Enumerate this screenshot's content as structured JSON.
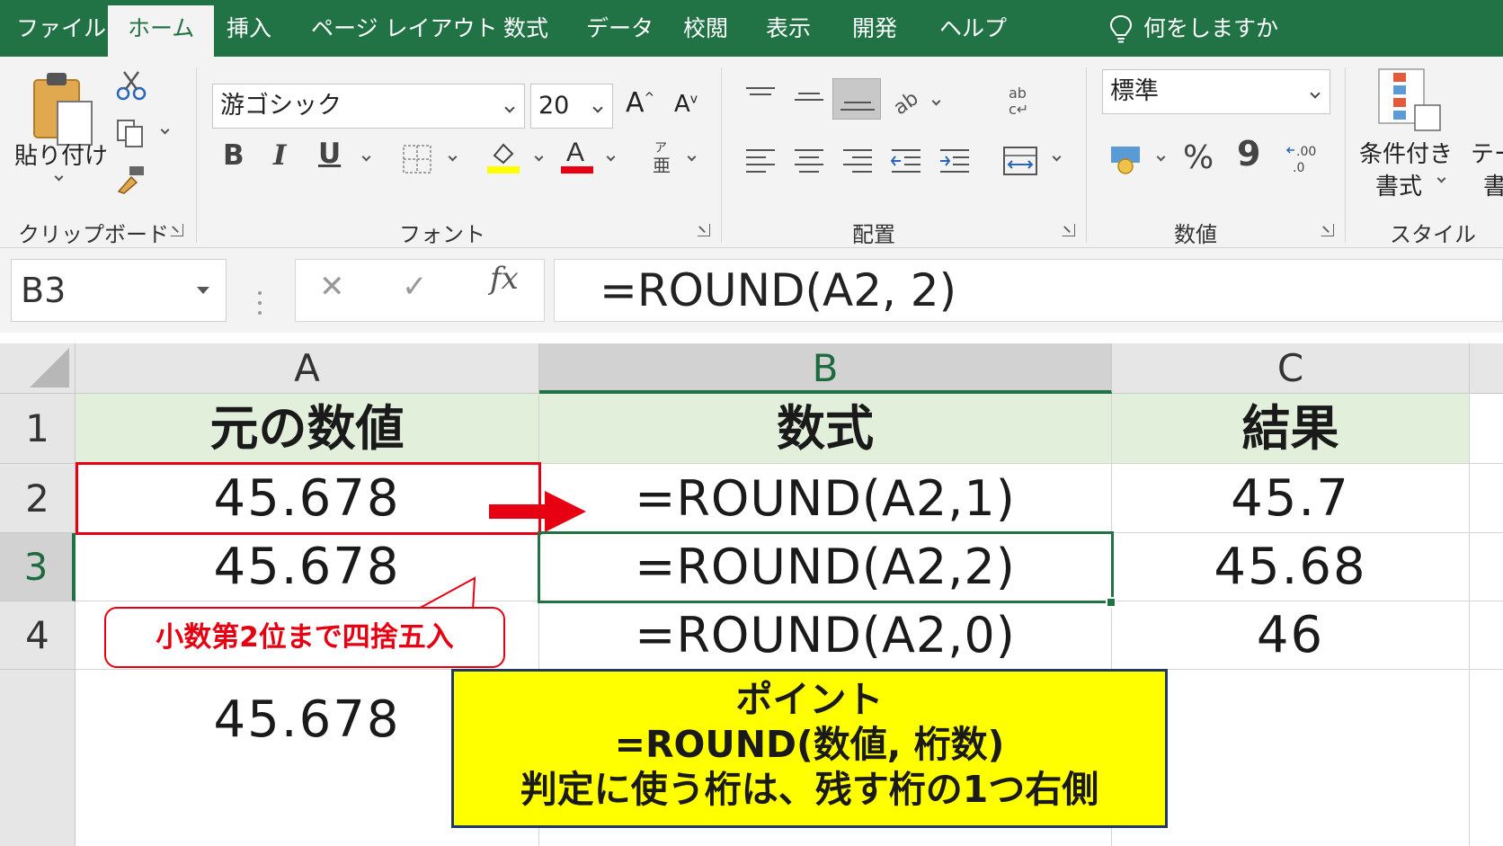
{
  "tabs": [
    "ファイル",
    "ホーム",
    "挿入",
    "ページ レイアウト",
    "数式",
    "データ",
    "校閲",
    "表示",
    "開発",
    "ヘルプ"
  ],
  "active_tab": "ホーム",
  "tell_me": "何をしますか",
  "ribbon": {
    "clipboard": {
      "paste_label": "貼り付け",
      "group_label": "クリップボード"
    },
    "font": {
      "font_name": "游ゴシック",
      "font_size": "20",
      "group_label": "フォント",
      "bold": "B",
      "italic": "I",
      "underline": "U"
    },
    "alignment": {
      "group_label": "配置"
    },
    "number": {
      "format": "標準",
      "percent": "%",
      "comma": "9",
      "group_label": "数値"
    },
    "styles": {
      "conditional_line1": "条件付き",
      "conditional_line2": "書式",
      "table_line1": "テー",
      "table_line2": "書",
      "group_label": "スタイル"
    }
  },
  "formula_bar": {
    "name_box": "B3",
    "cancel": "✕",
    "enter": "✓",
    "fx": "fx",
    "formula": "=ROUND(A2, 2)"
  },
  "sheet": {
    "columns": [
      "A",
      "B",
      "C"
    ],
    "rows": [
      "1",
      "2",
      "3",
      "4"
    ],
    "cells": [
      [
        "元の数値",
        "数式",
        "結果"
      ],
      [
        "45.678",
        "=ROUND(A2,1)",
        "45.7"
      ],
      [
        "45.678",
        "=ROUND(A2,2)",
        "45.68"
      ],
      [
        "",
        "=ROUND(A2,0)",
        "46"
      ],
      [
        "45.678",
        "",
        ""
      ]
    ],
    "selected_cell": "B3"
  },
  "callout": "小数第2位まで四捨五入",
  "note": {
    "line1": "ポイント",
    "line2": "=ROUND(数値, 桁数)",
    "line3": "判定に使う桁は、残す桁の1つ右側"
  },
  "colors": {
    "excel_green": "#217346",
    "header_fill": "#e2efda",
    "highlight_red": "#e60012",
    "note_fill": "#ffff00",
    "note_border": "#1f3864"
  }
}
